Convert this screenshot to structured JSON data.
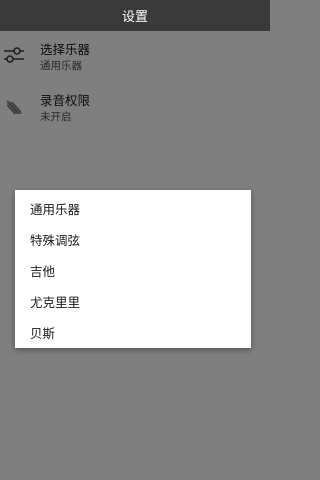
{
  "header": {
    "title": "设置"
  },
  "settings": {
    "instrument": {
      "title": "选择乐器",
      "value": "通用乐器",
      "icon": "sliders-icon"
    },
    "record": {
      "title": "录音权限",
      "value": "未开启",
      "icon": "microphone-icon"
    }
  },
  "dialog": {
    "options": [
      "通用乐器",
      "特殊调弦",
      "吉他",
      "尤克里里",
      "贝斯"
    ]
  },
  "colors": {
    "topbar": "#3a3a3a",
    "scrim": "rgba(0,0,0,0.5)",
    "dialog_bg": "#ffffff"
  }
}
